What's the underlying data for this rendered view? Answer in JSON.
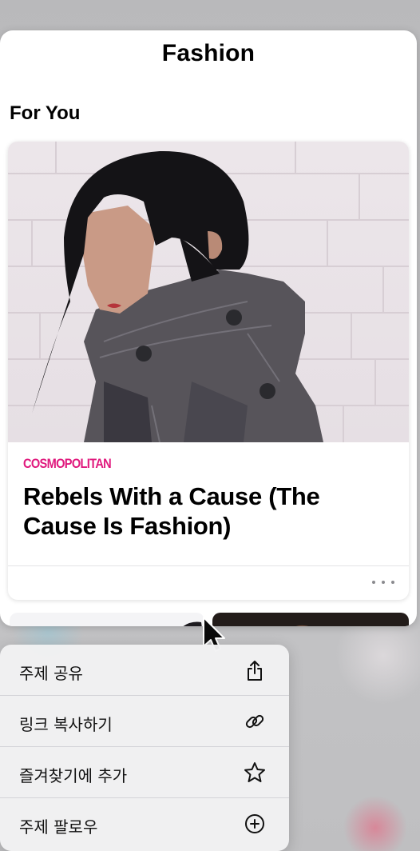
{
  "page": {
    "title": "Fashion"
  },
  "section": {
    "title": "For You"
  },
  "article": {
    "publisher": "COSMOPOLITAN",
    "headline": "Rebels With a Cause (The Cause Is Fashion)",
    "publisher_color": "#e0197d"
  },
  "context_menu": {
    "items": [
      {
        "label": "주제 공유",
        "icon": "share-icon"
      },
      {
        "label": "링크 복사하기",
        "icon": "link-icon"
      },
      {
        "label": "즐겨찾기에 추가",
        "icon": "star-icon"
      },
      {
        "label": "주제 팔로우",
        "icon": "plus-circle-icon"
      }
    ]
  },
  "colors": {
    "accent": "#e0197d",
    "background": "#ffffff",
    "menu": "#f1f1f3"
  }
}
